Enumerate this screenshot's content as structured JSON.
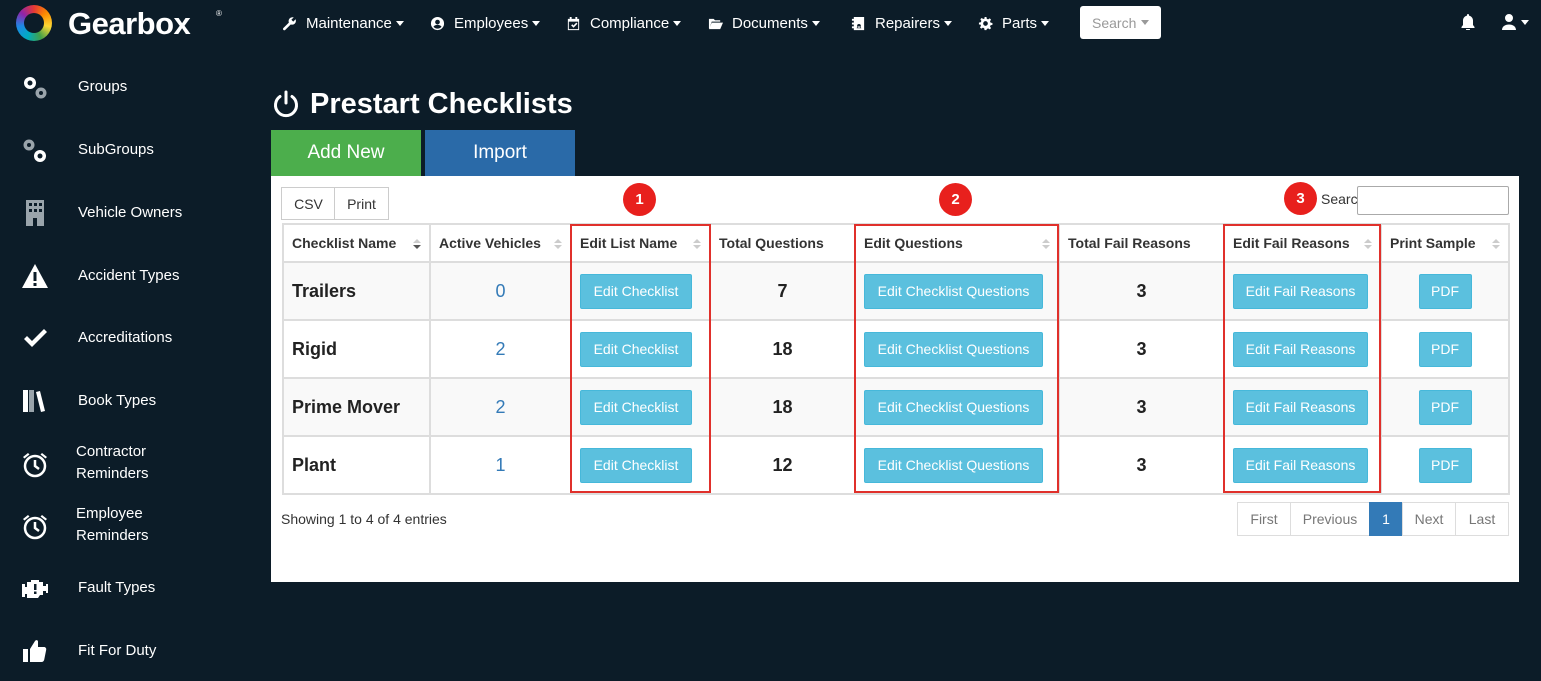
{
  "app": {
    "name": "Gearbox",
    "trademark": "®"
  },
  "nav": {
    "items": [
      {
        "label": "Maintenance",
        "icon": "wrench-icon"
      },
      {
        "label": "Employees",
        "icon": "user-circle-icon"
      },
      {
        "label": "Compliance",
        "icon": "calendar-check-icon"
      },
      {
        "label": "Documents",
        "icon": "folder-open-icon"
      },
      {
        "label": "Repairers",
        "icon": "contact-card-icon"
      },
      {
        "label": "Parts",
        "icon": "gear-icon"
      }
    ],
    "search_label": "Search"
  },
  "sidebar": {
    "items": [
      {
        "label": "Groups",
        "icon": "cogs-icon"
      },
      {
        "label": "SubGroups",
        "icon": "cogs-icon"
      },
      {
        "label": "Vehicle Owners",
        "icon": "building-icon"
      },
      {
        "label": "Accident Types",
        "icon": "warning-icon"
      },
      {
        "label": "Accreditations",
        "icon": "checkmark-icon"
      },
      {
        "label": "Book Types",
        "icon": "books-icon"
      },
      {
        "label_line1": "Contractor",
        "label_line2": "Reminders",
        "icon": "alarm-clock-icon"
      },
      {
        "label_line1": "Employee",
        "label_line2": "Reminders",
        "icon": "alarm-clock-icon"
      },
      {
        "label": "Fault Types",
        "icon": "engine-warning-icon"
      },
      {
        "label": "Fit For Duty",
        "icon": "thumbs-up-icon"
      }
    ]
  },
  "page": {
    "title": "Prestart Checklists",
    "add_new_label": "Add New",
    "import_label": "Import"
  },
  "toolbar": {
    "csv_label": "CSV",
    "print_label": "Print",
    "search_label": "Search:"
  },
  "table": {
    "headers": [
      "Checklist Name",
      "Active Vehicles",
      "Edit List Name",
      "Total Questions",
      "Edit Questions",
      "Total Fail Reasons",
      "Edit Fail Reasons",
      "Print Sample"
    ],
    "rows": [
      {
        "name": "Trailers",
        "active": "0",
        "edit": "Edit Checklist",
        "questions": "7",
        "edit_questions": "Edit Checklist Questions",
        "fail_reasons": "3",
        "edit_fail": "Edit Fail Reasons",
        "pdf": "PDF"
      },
      {
        "name": "Rigid",
        "active": "2",
        "edit": "Edit Checklist",
        "questions": "18",
        "edit_questions": "Edit Checklist Questions",
        "fail_reasons": "3",
        "edit_fail": "Edit Fail Reasons",
        "pdf": "PDF"
      },
      {
        "name": "Prime Mover",
        "active": "2",
        "edit": "Edit Checklist",
        "questions": "18",
        "edit_questions": "Edit Checklist Questions",
        "fail_reasons": "3",
        "edit_fail": "Edit Fail Reasons",
        "pdf": "PDF"
      },
      {
        "name": "Plant",
        "active": "1",
        "edit": "Edit Checklist",
        "questions": "12",
        "edit_questions": "Edit Checklist Questions",
        "fail_reasons": "3",
        "edit_fail": "Edit Fail Reasons",
        "pdf": "PDF"
      }
    ]
  },
  "footer": {
    "showing": "Showing 1 to 4 of 4 entries",
    "pager": [
      "First",
      "Previous",
      "1",
      "Next",
      "Last"
    ]
  },
  "annotations": {
    "badges": [
      "1",
      "2",
      "3"
    ],
    "color": "#e0302b"
  },
  "colors": {
    "background": "#0c1c28",
    "success": "#4cae4c",
    "primary": "#2a6aa8",
    "info": "#5bc0de",
    "link": "#337ab7"
  }
}
